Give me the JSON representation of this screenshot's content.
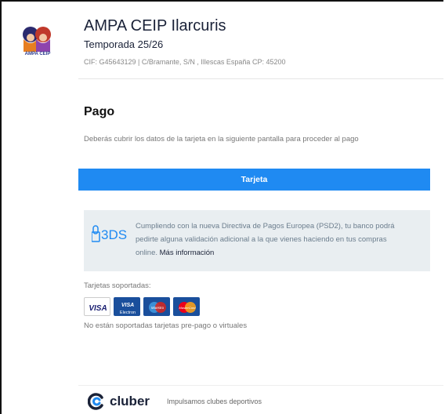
{
  "header": {
    "logo_text": "AMPA CEIP",
    "club_name": "AMPA CEIP Ilarcuris",
    "season": "Temporada 25/26",
    "legal_info": "CIF: G45643129 | C/Bramante, S/N , Illescas España CP: 45200"
  },
  "payment": {
    "title": "Pago",
    "description": "Deberás cubrir los datos de la tarjeta en la siguiente pantalla para proceder al pago",
    "card_button_label": "Tarjeta",
    "button_color": "#1f8af2"
  },
  "notice": {
    "logo_text": "3DS",
    "text": "Cumpliendo con la nueva Directiva de Pagos Europea (PSD2), tu banco podrá pedirte alguna validación adicional a la que vienes haciendo en tus compras online.",
    "link_label": "Más información"
  },
  "cards": {
    "label": "Tarjetas soportadas:",
    "logos": [
      {
        "name": "VISA"
      },
      {
        "name": "VISA Electron"
      },
      {
        "name": "Maestro"
      },
      {
        "name": "MasterCard"
      }
    ],
    "unsupported_note": "No están soportadas tarjetas pre-pago o virtuales"
  },
  "footer": {
    "brand": "cluber",
    "tagline": "Impulsamos clubes deportivos"
  }
}
